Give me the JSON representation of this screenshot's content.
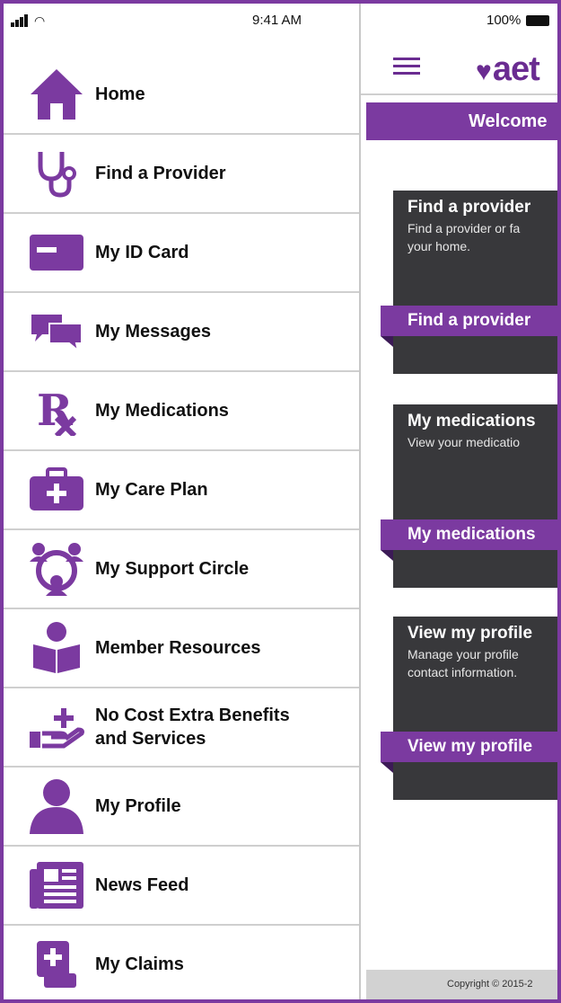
{
  "status_bar": {
    "time": "9:41 AM",
    "battery": "100%"
  },
  "header": {
    "brand": "aet",
    "welcome": "Welcome"
  },
  "cards": [
    {
      "title": "Find a provider",
      "desc_line1": "Find a provider or fa",
      "desc_line2": "your home.",
      "button": "Find a provider"
    },
    {
      "title": "My medications",
      "desc_line1": "View your medicatio",
      "desc_line2": "",
      "button": "My medications"
    },
    {
      "title": "View my profile",
      "desc_line1": "Manage your profile",
      "desc_line2": "contact information.",
      "button": "View my profile"
    }
  ],
  "footer": {
    "copyright": "Copyright © 2015-2"
  },
  "menu": [
    {
      "label": "Home",
      "icon": "home-icon"
    },
    {
      "label": "Find a Provider",
      "icon": "stethoscope-icon"
    },
    {
      "label": "My ID Card",
      "icon": "id-card-icon"
    },
    {
      "label": "My Messages",
      "icon": "messages-icon"
    },
    {
      "label": "My Medications",
      "icon": "rx-icon"
    },
    {
      "label": "My Care Plan",
      "icon": "care-plan-icon"
    },
    {
      "label": "My Support Circle",
      "icon": "support-circle-icon"
    },
    {
      "label": "Member Resources",
      "icon": "member-resources-icon"
    },
    {
      "label": "No Cost Extra Benefits",
      "label_line2": "and Services",
      "icon": "extra-benefits-icon"
    },
    {
      "label": "My Profile",
      "icon": "profile-icon"
    },
    {
      "label": "News Feed",
      "icon": "news-feed-icon"
    },
    {
      "label": "My Claims",
      "icon": "claims-icon"
    }
  ],
  "colors": {
    "brand_purple": "#7b3aa0",
    "card_dark": "#38383b",
    "divider": "#cfcfcf"
  }
}
